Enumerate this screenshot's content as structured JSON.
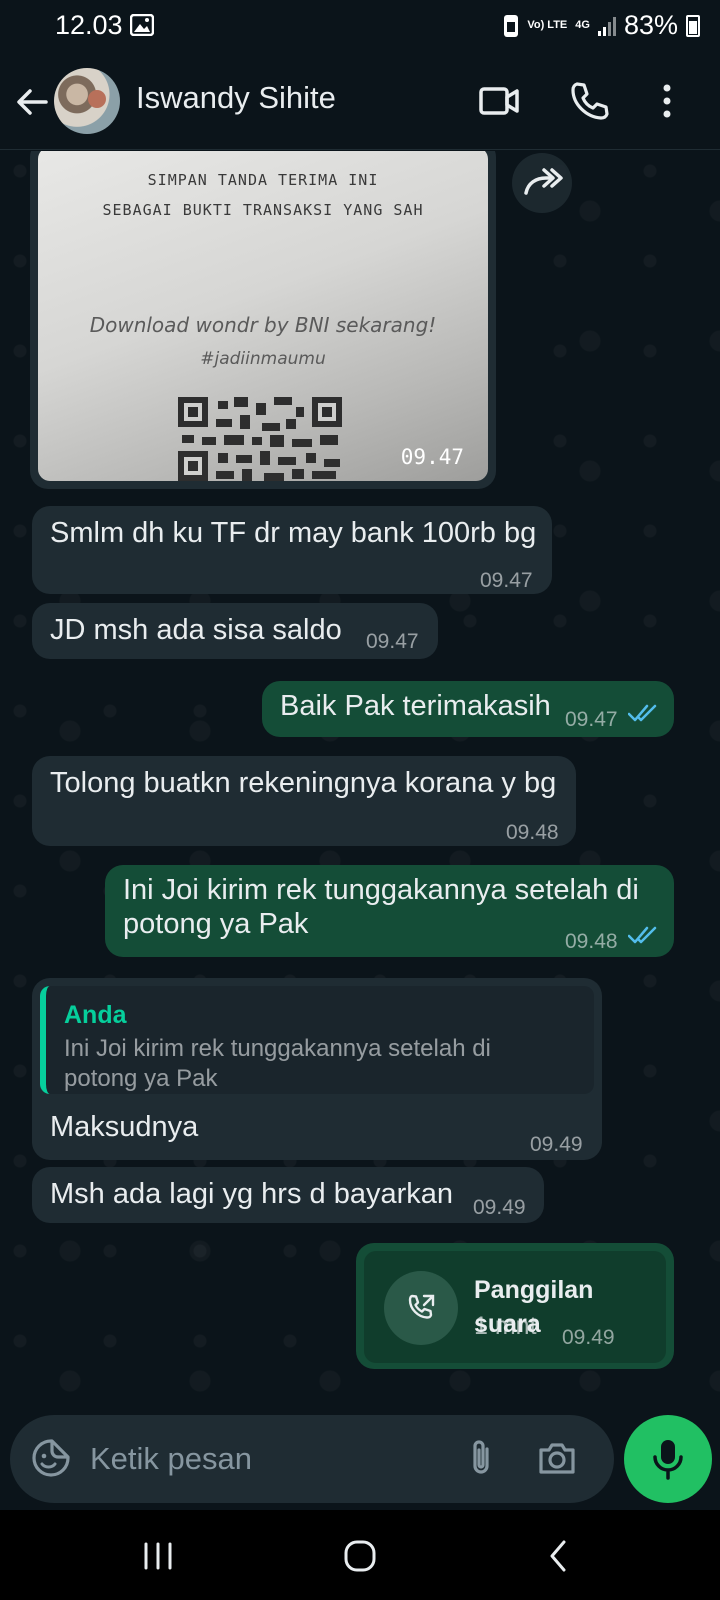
{
  "status_bar": {
    "time": "12.03",
    "battery": "83%",
    "network": "4G",
    "volte": "Vo) LTE"
  },
  "header": {
    "contact_name": "Iswandy Sihite"
  },
  "icons": {
    "back": "arrow-back-icon",
    "video": "video-call-icon",
    "voice": "phone-icon",
    "menu": "more-vert-icon",
    "emoji": "emoji-icon",
    "attach": "paperclip-icon",
    "camera": "camera-icon",
    "mic": "mic-icon",
    "forward": "forward-icon",
    "read": "double-check-icon"
  },
  "colors": {
    "incoming": "#1f2c33",
    "outgoing": "#144d37",
    "accent": "#21c063",
    "read_ticks": "#53bdeb",
    "quote_bar": "#06cf9c"
  },
  "image_message": {
    "lines": [
      "SIMPAN TANDA TERIMA INI",
      "SEBAGAI BUKTI TRANSAKSI YANG SAH",
      "Download wondr by BNI sekarang!",
      "#jadiinmaumu"
    ],
    "time": "09.47"
  },
  "messages": [
    {
      "text": "Smlm dh ku TF dr may bank 100rb bg",
      "time": "09.47"
    },
    {
      "text": "JD msh ada sisa saldo",
      "time": "09.47"
    },
    {
      "text": "Baik Pak terimakasih",
      "time": "09.47"
    },
    {
      "text": "Tolong buatkn rekeningnya korana y bg",
      "time": "09.48"
    },
    {
      "line1": "Ini Joi kirim rek tunggakannya setelah di",
      "line2": "potong ya Pak",
      "time": "09.48"
    },
    {
      "quote_author": "Anda",
      "quote_line1": "Ini Joi kirim rek tunggakannya setelah di",
      "quote_line2": "potong ya Pak",
      "text": "Maksudnya",
      "time": "09.49"
    },
    {
      "text": "Msh ada lagi yg hrs d bayarkan",
      "time": "09.49"
    }
  ],
  "call_message": {
    "title": "Panggilan suara",
    "duration": "1 mnt",
    "time": "09.49"
  },
  "composer": {
    "placeholder": "Ketik pesan"
  }
}
